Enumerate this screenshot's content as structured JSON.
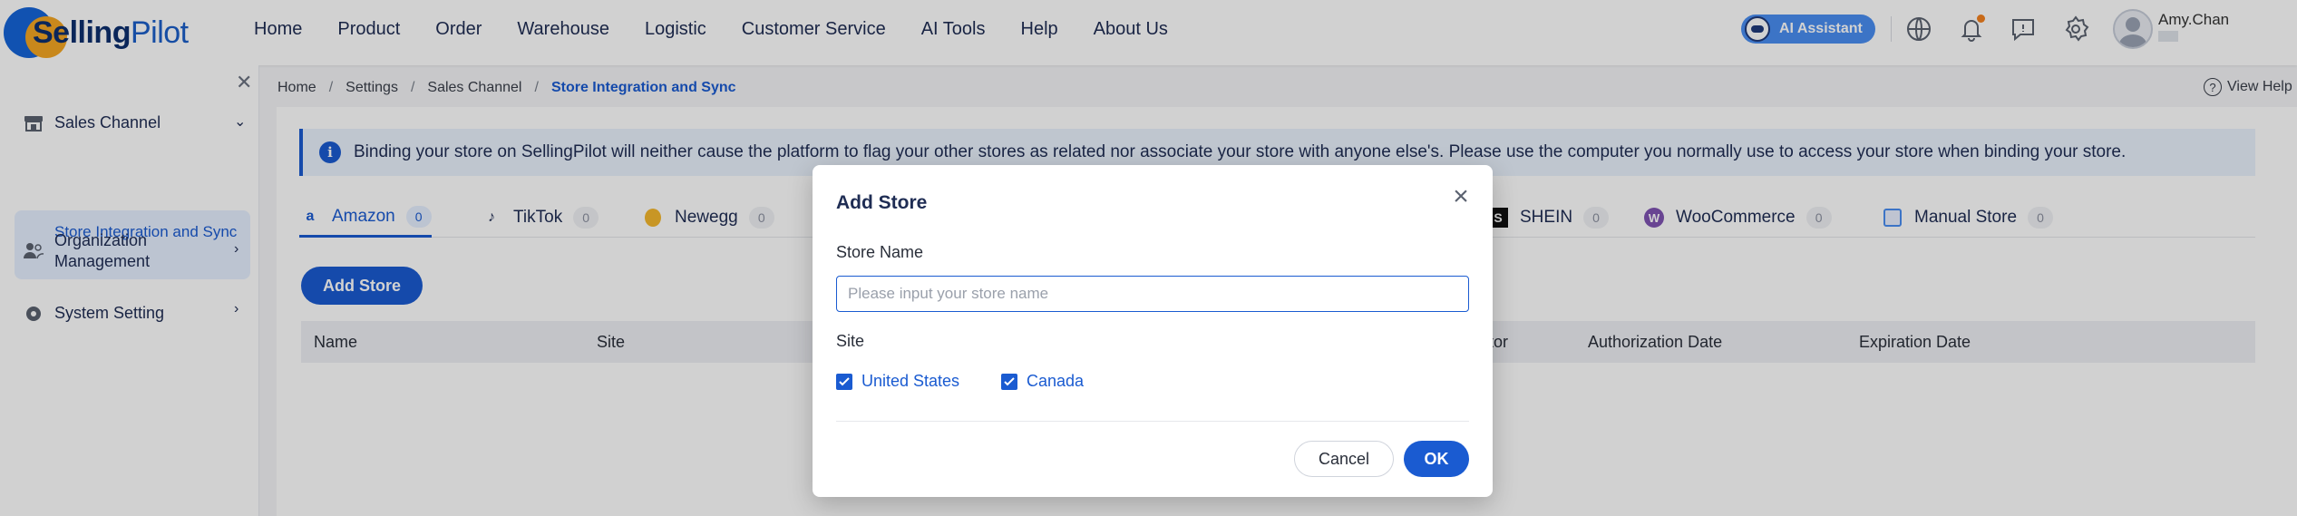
{
  "brand": {
    "name_bold": "Selling",
    "name_light": "Pilot"
  },
  "nav": [
    "Home",
    "Product",
    "Order",
    "Warehouse",
    "Logistic",
    "Customer Service",
    "AI Tools",
    "Help",
    "About Us"
  ],
  "header": {
    "ai_assistant": "AI Assistant",
    "user_name": "Amy.Chan",
    "icons": [
      "globe-icon",
      "bell-icon",
      "message-icon",
      "gear-icon"
    ]
  },
  "sidebar": {
    "groups": [
      {
        "label": "Sales Channel",
        "icon": "store-icon",
        "expanded": true
      },
      {
        "label": "Organization Management",
        "icon": "users-icon",
        "expanded": false
      },
      {
        "label": "System Setting",
        "icon": "gear-icon",
        "expanded": false
      }
    ],
    "active_item": "Store Integration and Sync"
  },
  "breadcrumb": [
    "Home",
    "Settings",
    "Sales Channel",
    "Store Integration and Sync"
  ],
  "view_help": "View Help",
  "notice": "Binding your store on SellingPilot will neither cause the platform to flag your other stores as related nor associate your store with anyone else's. Please use the computer you normally use to access your store when binding your store.",
  "tabs": [
    {
      "label": "Amazon",
      "count": "0",
      "active": true
    },
    {
      "label": "TikTok",
      "count": "0"
    },
    {
      "label": "Newegg",
      "count": "0"
    },
    {
      "label": "SHEIN",
      "count": "0"
    },
    {
      "label": "WooCommerce",
      "count": "0"
    },
    {
      "label": "Manual Store",
      "count": "0"
    }
  ],
  "add_store_button": "Add Store",
  "table_headers": [
    "Name",
    "Site",
    "ator",
    "Authorization Date",
    "Expiration Date"
  ],
  "modal": {
    "title": "Add Store",
    "store_name_label": "Store Name",
    "store_name_placeholder": "Please input your store name",
    "site_label": "Site",
    "sites": [
      {
        "label": "United States",
        "checked": true
      },
      {
        "label": "Canada",
        "checked": true
      }
    ],
    "cancel": "Cancel",
    "ok": "OK"
  },
  "colors": {
    "primary": "#1a5bd1",
    "accent": "#f5a623",
    "nav_text": "#1f2d54"
  }
}
